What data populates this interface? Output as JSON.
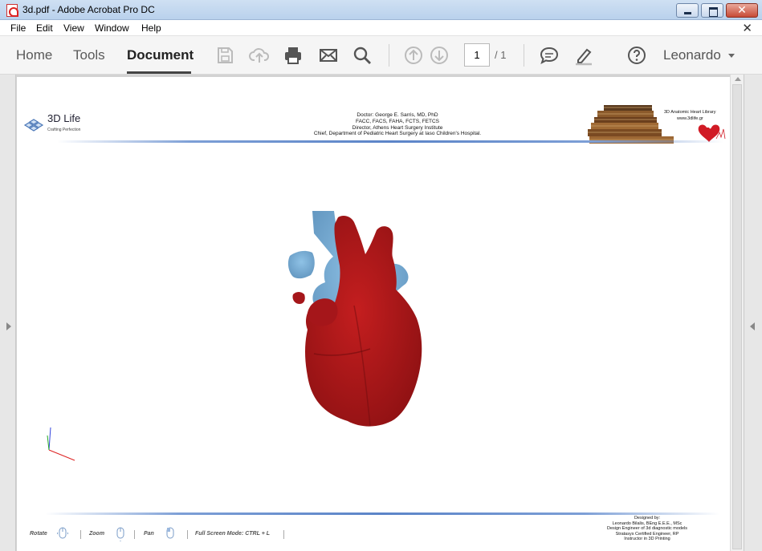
{
  "window": {
    "title": "3d.pdf - Adobe Acrobat Pro DC",
    "buttons": {
      "minimize": "minimize",
      "maximize": "maximize",
      "close": "✕"
    }
  },
  "menu": {
    "items": [
      "File",
      "Edit",
      "View",
      "Window",
      "Help"
    ],
    "close_doc": "✕"
  },
  "toolbar": {
    "tabs": [
      "Home",
      "Tools",
      "Document"
    ],
    "active_tab": "Document",
    "page_current": "1",
    "page_total": "/ 1",
    "user": "Leonardo",
    "icons": [
      "save-icon",
      "upload-icon",
      "print-icon",
      "email-icon",
      "search-icon",
      "prev-page-icon",
      "next-page-icon",
      "comment-icon",
      "highlight-icon",
      "help-icon"
    ]
  },
  "pdf": {
    "logo_brand": "3D Life",
    "logo_tagline": "Crafting Perfection",
    "header_lines": [
      "Doctor: George E. Sarris, MD, PhD",
      "FACC, FACS, FAHA, FCTS, FETCS",
      "Director, Athens Heart Surgery Institute",
      "Chief, Department of Pediatric Heart Surgery at Iaso Children's Hospital."
    ],
    "library_title": "3D Anatomic Heart Library",
    "library_url": "www.3dlife.gr",
    "controls": {
      "rotate": "Rotate",
      "zoom": "Zoom",
      "pan": "Pan",
      "fullscreen": "Full Screen Mode:  CTRL + L"
    },
    "designed_lines": [
      "Designed by:",
      "Leonardo Bilalis, BEng E.E.E., MSc",
      "Design Engineer of 3d diagnostic models",
      "Stratasys Certified Engineer, RP",
      "Instructor in 3D Printing"
    ]
  },
  "colors": {
    "heart_red": "#b3191a",
    "vessel_blue": "#7fb3d8",
    "rule_blue": "#5b84c8"
  }
}
